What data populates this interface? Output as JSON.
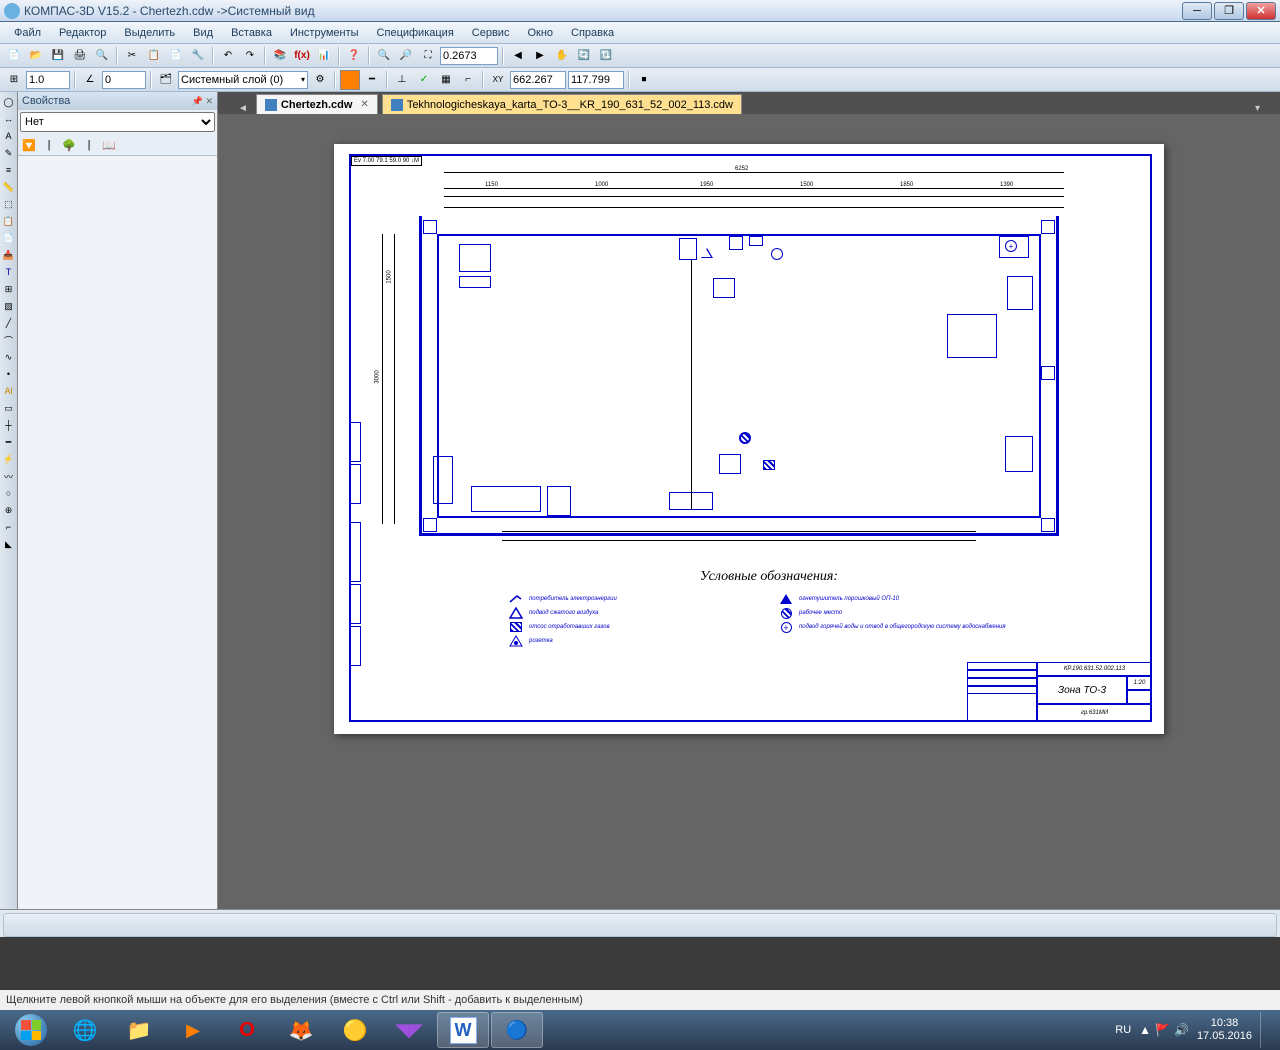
{
  "titlebar": {
    "app_title": "КОМПАС-3D V15.2 - Chertezh.cdw ->Системный вид"
  },
  "menu": {
    "file": "Файл",
    "edit": "Редактор",
    "select": "Выделить",
    "view": "Вид",
    "insert": "Вставка",
    "tools": "Инструменты",
    "spec": "Спецификация",
    "service": "Сервис",
    "window": "Окно",
    "help": "Справка"
  },
  "toolbar2": {
    "step": "1.0",
    "angle": "0",
    "layer": "Системный слой (0)",
    "coord_x": "662.267",
    "coord_y": "117.799",
    "zoom": "0.2673"
  },
  "properties": {
    "panel_title": "Свойства",
    "selector_value": "Нет"
  },
  "tabs": {
    "active": "Chertezh.cdw",
    "inactive": "Tekhnologicheskaya_karta_TO-3__KR_190_631_52_002_113.cdw"
  },
  "drawing": {
    "coord_stamp": "Ev 7.00 79.1 59.0 90 ↓M",
    "dim_total": "6252",
    "dim1": "1150",
    "dim2": "1000",
    "dim3": "1950",
    "dim4": "1500",
    "dim5": "1850",
    "dim6": "1390",
    "dim_h1": "1500",
    "dim_h2": "3000",
    "legend_title": "Условные обозначения:",
    "legend": {
      "l1": "потребитель электроэнергии",
      "l2": "подвод сжатого воздуха",
      "l3": "отсос отработавших газов",
      "l4": "розетка",
      "r1": "огнетушитель порошковый ОП-10",
      "r2": "рабочее место",
      "r3": "подвод горячей воды и отвод в общегородскую систему водоснабжения"
    },
    "title_block": {
      "code": "КР.190.631.52.002.113",
      "name": "Зона ТО-3",
      "group": "гр.631МИ",
      "scale": "1:20"
    }
  },
  "status": {
    "hint": "Щелкните левой кнопкой мыши на объекте для его выделения (вместе с Ctrl или Shift - добавить к выделенным)"
  },
  "tray": {
    "lang": "RU",
    "time": "10:38",
    "date": "17.05.2016"
  }
}
